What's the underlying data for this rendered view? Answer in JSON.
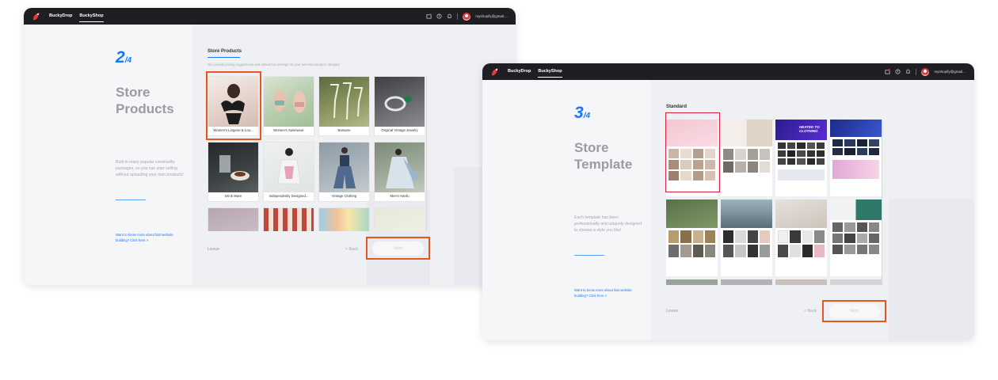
{
  "window1": {
    "nav": {
      "tab1": "BuckyDrop",
      "tab2": "BuckyShop",
      "email": "myshopify@gmail...."
    },
    "step": {
      "num": "2",
      "den": "/4",
      "title": "Store Products",
      "desc": "Built in many popular commodity packages, so you can start selling without uploading your own products!",
      "link": "Want to know more about fast website building? Click here >"
    },
    "section": {
      "title": "Store Products",
      "subtitle": "We provide pricing suggestions and default tax settings for your selected product category"
    },
    "products": [
      {
        "name": "Women's Lingerie & Lou..."
      },
      {
        "name": "Women's Swimwear"
      },
      {
        "name": "Barware"
      },
      {
        "name": "Original Vintage Jewelry"
      },
      {
        "name": "Drink Ware"
      },
      {
        "name": "Independently Designed..."
      },
      {
        "name": "Vintage Clothing"
      },
      {
        "name": "Men's Hanfu"
      }
    ],
    "actions": {
      "leave": "Leave",
      "back": "< Back",
      "next": "Next"
    }
  },
  "window2": {
    "nav": {
      "tab1": "BuckyDrop",
      "tab2": "BuckyShop",
      "email": "myshopify@gmail...."
    },
    "step": {
      "num": "3",
      "den": "/4",
      "title": "Store Template",
      "desc": "Each template has been professionally and uniquely designed to choose a style you like!",
      "link": "Want to know more about fast website building? Click here >"
    },
    "section": {
      "title": "Standard"
    },
    "templates": [
      {
        "headline": ""
      },
      {
        "headline": ""
      },
      {
        "headline": "HEATED TO CLOTHING"
      },
      {
        "headline": ""
      },
      {
        "headline": ""
      },
      {
        "headline": ""
      },
      {
        "headline": ""
      },
      {
        "headline": ""
      }
    ],
    "actions": {
      "leave": "Leave",
      "back": "< Back",
      "next": "Next"
    }
  },
  "colors": {
    "accent": "#1677ff",
    "highlight_orange": "#e8561f",
    "highlight_red": "#d6203d",
    "topbar": "#1f1f23"
  },
  "icons": [
    "buckydrop-logo-icon",
    "store-icon",
    "help-icon",
    "bell-icon"
  ]
}
